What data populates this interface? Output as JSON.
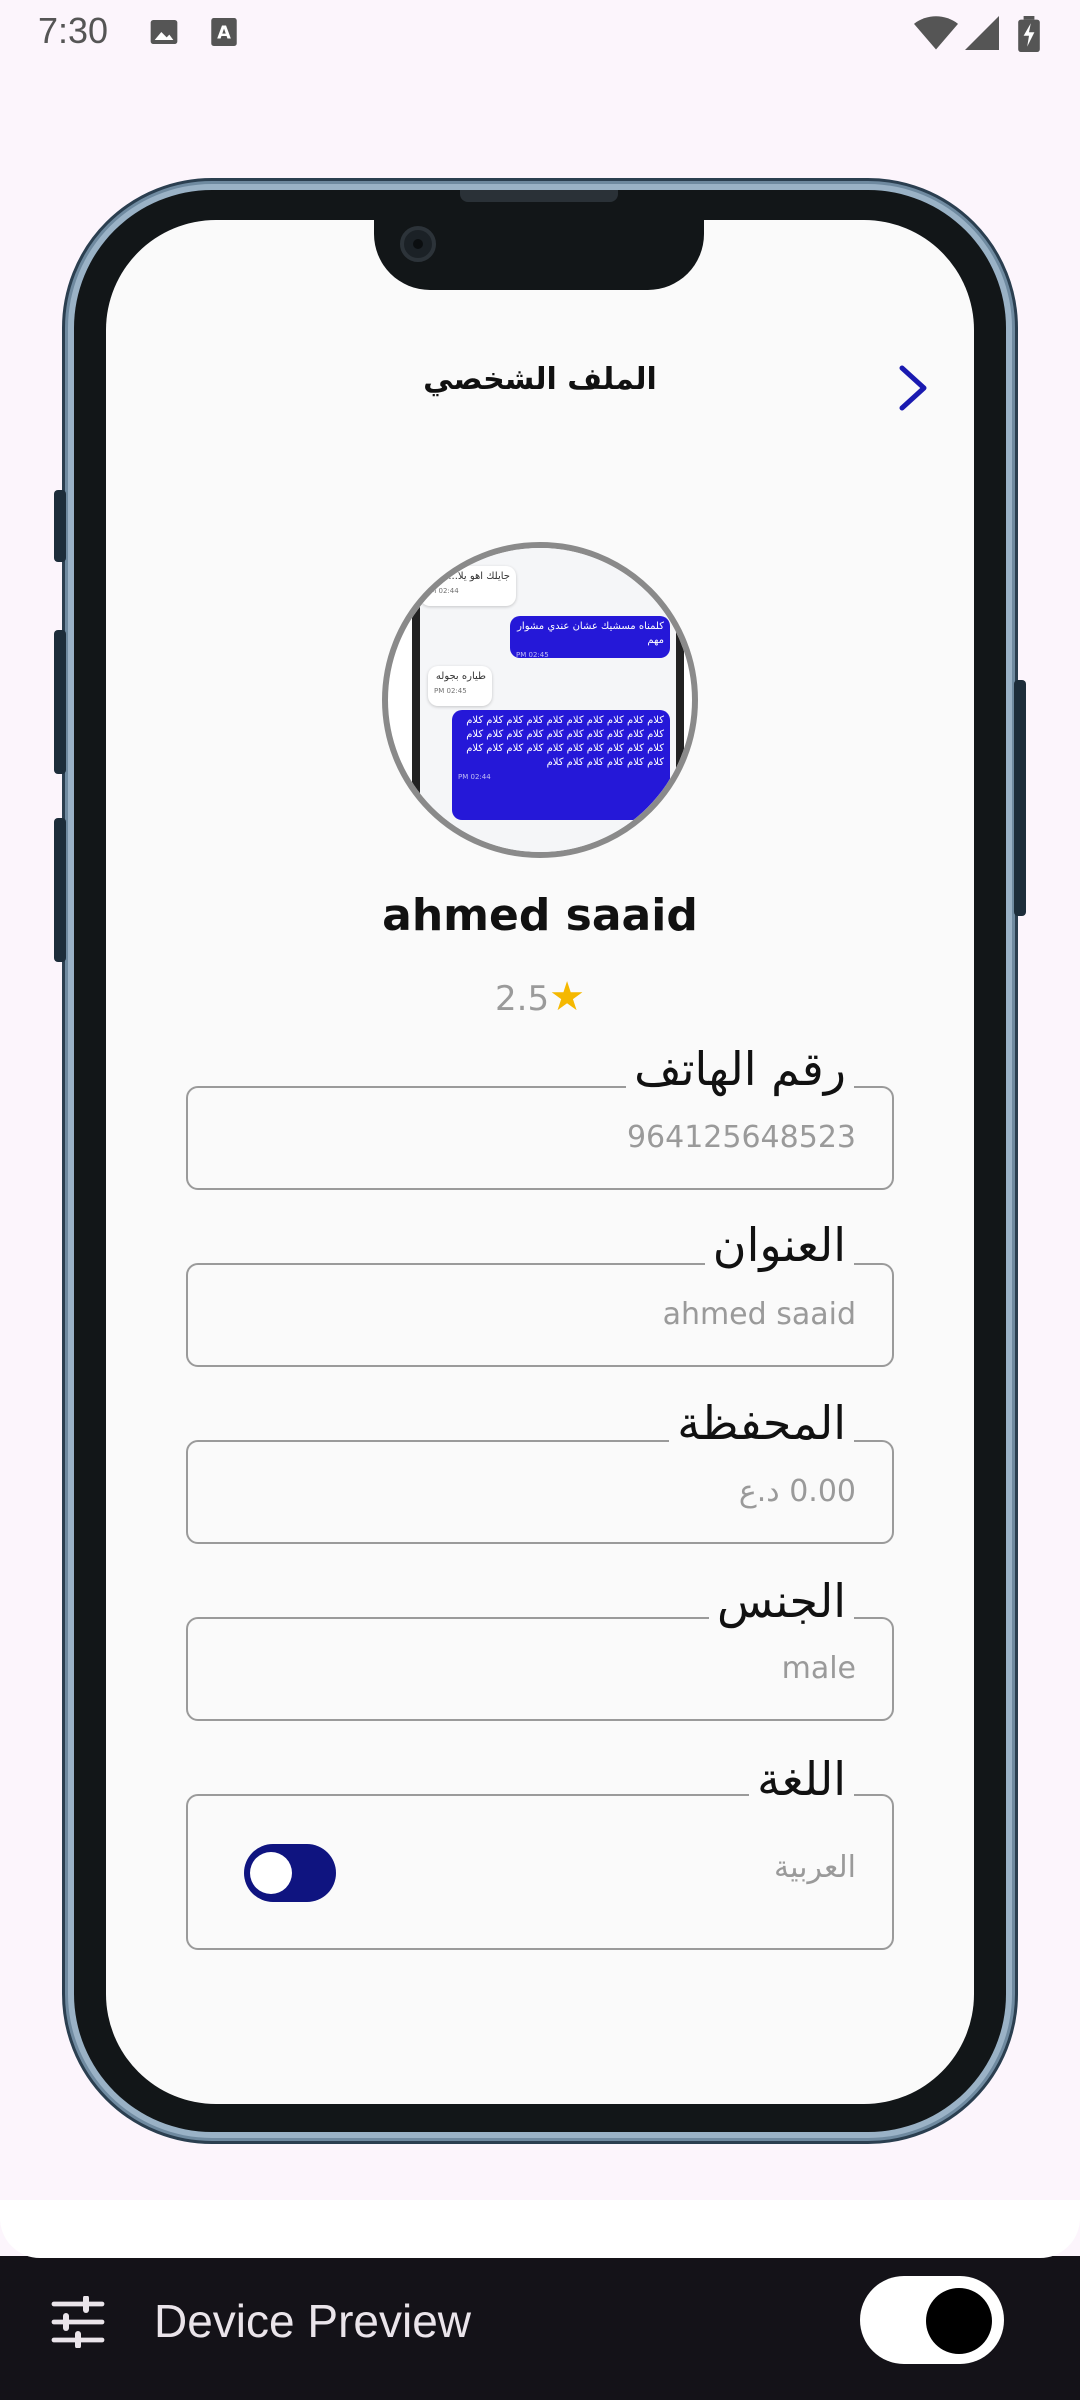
{
  "status_bar": {
    "time": "7:30",
    "icons": [
      "image-icon",
      "text-a-icon",
      "wifi-icon",
      "signal-icon",
      "battery-charging-icon"
    ]
  },
  "app": {
    "title": "الملف الشخصي",
    "back_icon": "chevron-right-icon",
    "avatar_preview": {
      "messages": [
        {
          "dir": "in",
          "text": "جايلك اهو يلا...",
          "time": "PM 02:44"
        },
        {
          "dir": "out",
          "text": "كلمناه مسشيك عشان عندي مشوار مهم",
          "time": "PM 02:45"
        },
        {
          "dir": "in",
          "text": "طياره بجوله",
          "time": "PM 02:45"
        },
        {
          "dir": "out",
          "text": "كلام كلام كلام كلام كلام كلام كلام كلام كلام كلام كلام كلام كلام كلام كلام كلام كلام كلام كلام كلام كلام كلام كلام كلام كلام كلام كلام كلام كلام كلام كلام كلام كلام كلام كلام كلام",
          "time": "PM 02:44"
        }
      ]
    },
    "username": "ahmed saaid",
    "rating": "2.5",
    "rating_icon": "star-icon",
    "fields": {
      "phone": {
        "label": "رقم الهاتف",
        "value": "964125648523"
      },
      "address": {
        "label": "العنوان",
        "value": "ahmed saaid"
      },
      "wallet": {
        "label": "المحفظة",
        "value": "0.00 د.ع"
      },
      "gender": {
        "label": "الجنس",
        "value": "male"
      },
      "language": {
        "label": "اللغة",
        "value": "العربية",
        "toggle_on": true
      }
    }
  },
  "device_preview": {
    "title": "Device Preview",
    "settings_icon": "sliders-icon",
    "switch_on": true
  },
  "colors": {
    "accent": "#1a1ab0",
    "toggle_track": "#0f1480",
    "star": "#f5b800",
    "bubble_out": "#2518d8"
  }
}
